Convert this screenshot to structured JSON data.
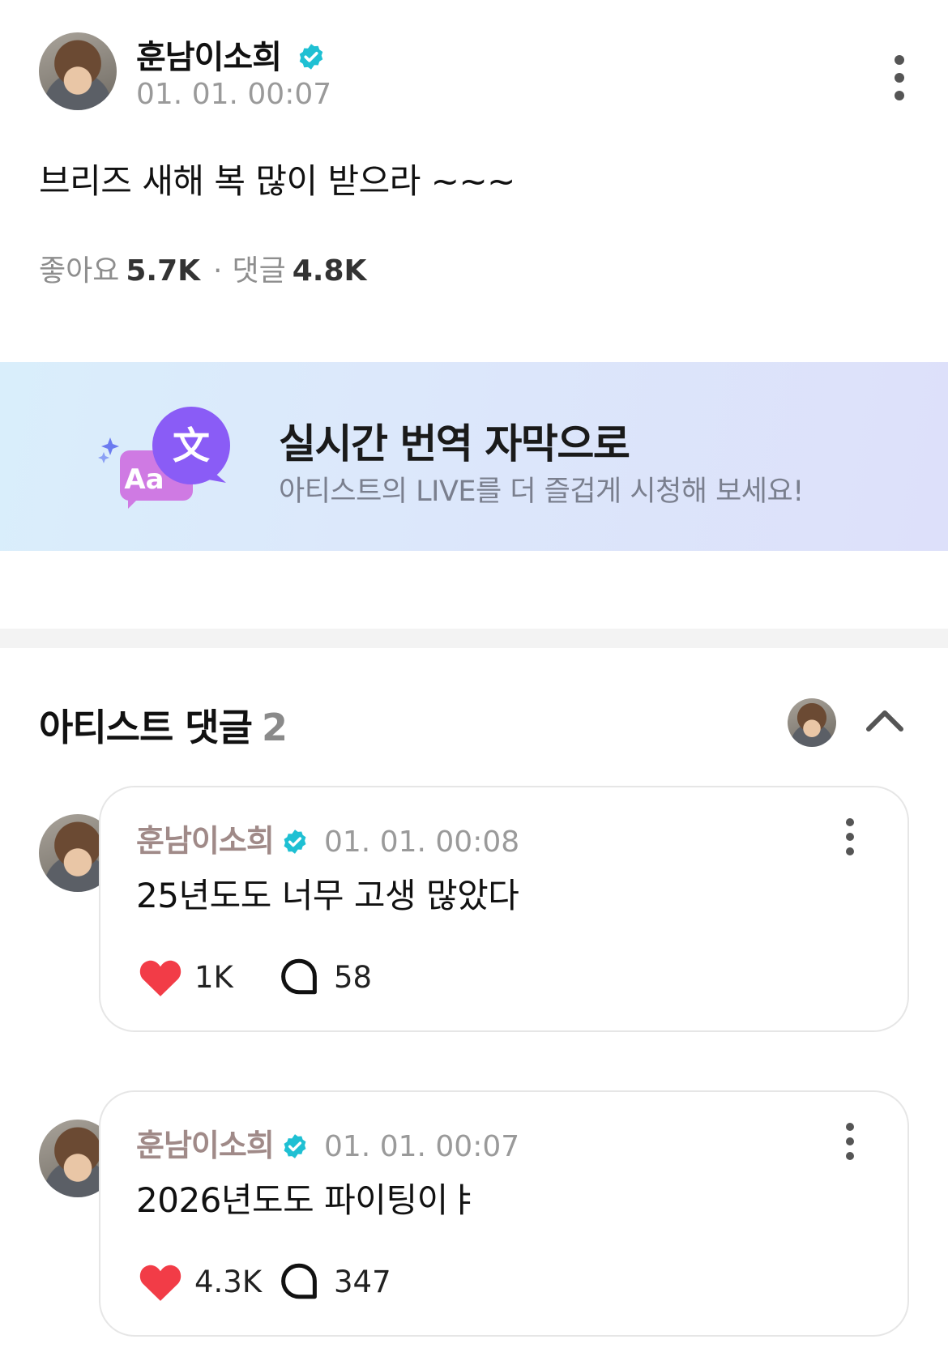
{
  "post": {
    "author": "훈남이소희",
    "timestamp": "01. 01. 00:07",
    "body": "브리즈 새해 복 많이 받으라 ~~~",
    "likes_label": "좋아요",
    "likes_count": "5.7K",
    "separator": "·",
    "comments_label": "댓글",
    "comments_count": "4.8K"
  },
  "banner": {
    "title": "실시간 번역 자막으로",
    "subtitle": "아티스트의 LIVE를 더 즐겁게 시청해 보세요!",
    "icon_glyph": "文",
    "icon_text": "Aa"
  },
  "artist_comments": {
    "title": "아티스트 댓글",
    "count": "2",
    "items": [
      {
        "author": "훈남이소희",
        "timestamp": "01. 01. 00:08",
        "body": "25년도도 너무 고생 많았다",
        "likes": "1K",
        "replies": "58"
      },
      {
        "author": "훈남이소희",
        "timestamp": "01. 01. 00:07",
        "body": "2026년도도 파이팅이ㅑ",
        "likes": "4.3K",
        "replies": "347"
      }
    ]
  },
  "colors": {
    "verified": "#1fc0d3",
    "heart": "#f23c47",
    "comment_author": "#a08a88",
    "banner_icon_purple": "#8a5cf6"
  },
  "icons": [
    "avatar",
    "verified-badge-icon",
    "more-vertical-icon",
    "translate-icon",
    "chevron-up-icon",
    "heart-icon",
    "comment-bubble-icon"
  ]
}
